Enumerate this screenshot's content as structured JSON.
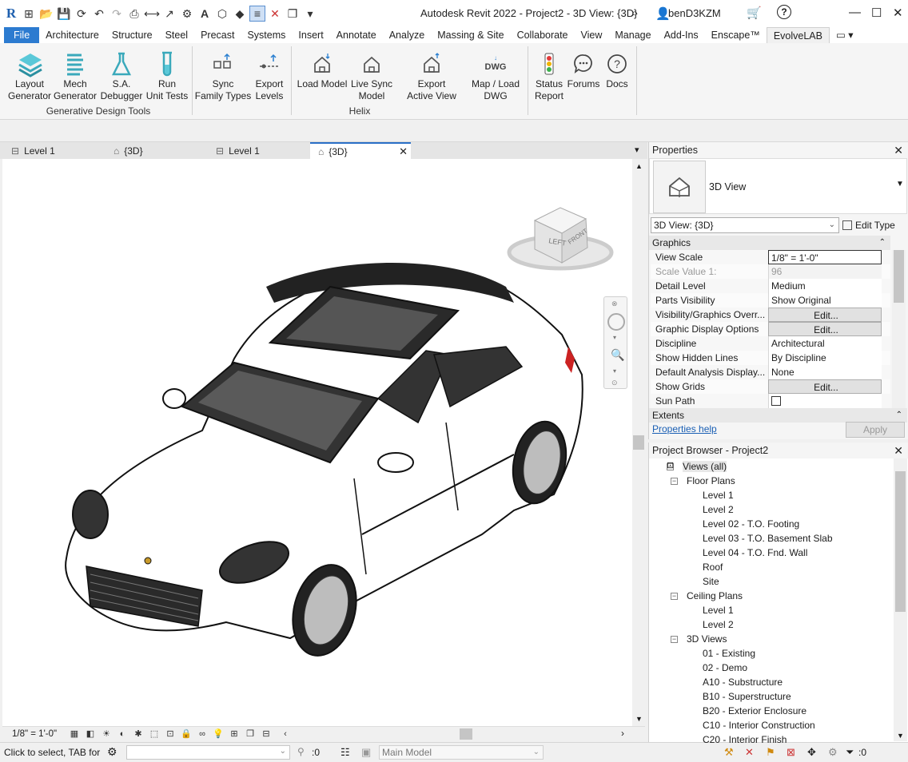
{
  "app": {
    "title": "Autodesk Revit 2022 - Project2 - 3D View: {3D}",
    "user": "benD3KZM",
    "help": "?"
  },
  "menu": {
    "tabs": [
      "File",
      "Architecture",
      "Structure",
      "Steel",
      "Precast",
      "Systems",
      "Insert",
      "Annotate",
      "Analyze",
      "Massing & Site",
      "Collaborate",
      "View",
      "Manage",
      "Add-Ins",
      "Enscape™",
      "EvolveLAB"
    ],
    "active": "EvolveLAB"
  },
  "ribbon": {
    "panels": [
      {
        "label": "Generative Design Tools",
        "buttons": [
          "Layout\nGenerator",
          "Mech\nGenerator",
          "S.A.\nDebugger",
          "Run\nUnit Tests"
        ]
      },
      {
        "label": "Helix",
        "buttons": [
          "Sync\nFamily Types",
          "Export\nLevels",
          "Load Model",
          "Live Sync\nModel",
          "Export\nActive View",
          "Map / Load\nDWG"
        ]
      },
      {
        "label": "",
        "buttons": [
          "Status\nReport",
          "Forums",
          "Docs"
        ]
      }
    ],
    "dwg_icon_text": "DWG"
  },
  "view_tabs": [
    {
      "label": "Level 1",
      "icon": "floor-plan-icon",
      "active": false
    },
    {
      "label": "{3D}",
      "icon": "3d-view-icon",
      "active": false
    },
    {
      "label": "Level 1",
      "icon": "floor-plan-icon",
      "active": false
    },
    {
      "label": "{3D}",
      "icon": "3d-view-icon",
      "active": true
    }
  ],
  "viewcube": {
    "left": "LEFT",
    "front": "FRONT"
  },
  "viewbar": {
    "scale": "1/8\" = 1'-0\""
  },
  "status": {
    "message": "Click to select, TAB for a",
    "selection_count": ":0",
    "model": "Main Model",
    "filter_count": ":0"
  },
  "properties": {
    "title": "Properties",
    "type_name": "3D View",
    "selector": "3D View: {3D}",
    "edit_type": "Edit Type",
    "group_graphics": "Graphics",
    "group_extents": "Extents",
    "rows": [
      {
        "key": "View Scale",
        "value": "1/8\" = 1'-0\"",
        "kind": "input"
      },
      {
        "key": "Scale Value    1:",
        "value": "96",
        "kind": "disabled"
      },
      {
        "key": "Detail Level",
        "value": "Medium",
        "kind": "text"
      },
      {
        "key": "Parts Visibility",
        "value": "Show Original",
        "kind": "text"
      },
      {
        "key": "Visibility/Graphics Overr...",
        "value": "Edit...",
        "kind": "button"
      },
      {
        "key": "Graphic Display Options",
        "value": "Edit...",
        "kind": "button"
      },
      {
        "key": "Discipline",
        "value": "Architectural",
        "kind": "text"
      },
      {
        "key": "Show Hidden Lines",
        "value": "By Discipline",
        "kind": "text"
      },
      {
        "key": "Default Analysis Display...",
        "value": "None",
        "kind": "text"
      },
      {
        "key": "Show Grids",
        "value": "Edit...",
        "kind": "button"
      },
      {
        "key": "Sun Path",
        "value": "",
        "kind": "checkbox"
      }
    ],
    "help_link": "Properties help",
    "apply": "Apply"
  },
  "browser": {
    "title": "Project Browser - Project2",
    "root": "Views (all)",
    "groups": [
      {
        "name": "Floor Plans",
        "items": [
          "Level 1",
          "Level 2",
          "Level 02 - T.O. Footing",
          "Level 03 - T.O. Basement Slab",
          "Level 04 - T.O. Fnd. Wall",
          "Roof",
          "Site"
        ]
      },
      {
        "name": "Ceiling Plans",
        "items": [
          "Level 1",
          "Level 2"
        ]
      },
      {
        "name": "3D Views",
        "items": [
          "01 - Existing",
          "02 - Demo",
          "A10 - Substructure",
          "B10 - Superstructure",
          "B20 - Exterior Enclosure",
          "C10 - Interior Construction",
          "C20 - Interior Finish"
        ]
      }
    ]
  }
}
